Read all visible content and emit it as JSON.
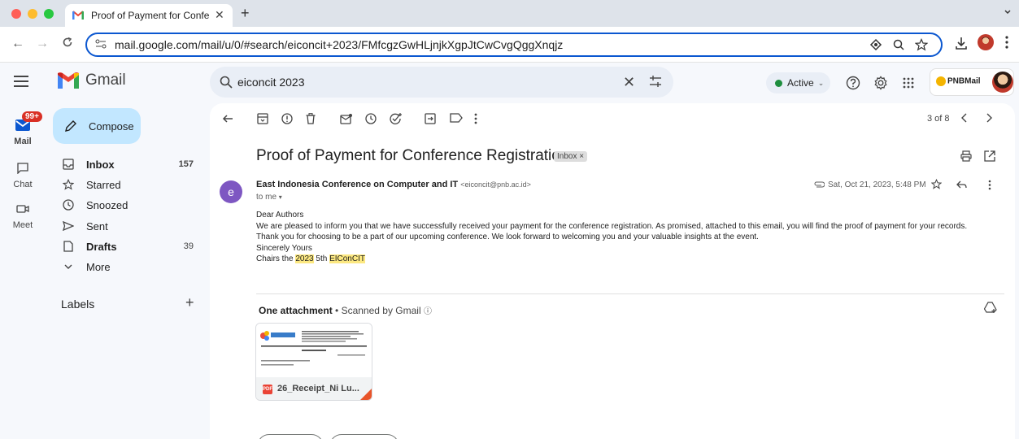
{
  "browser": {
    "tab_title": "Proof of Payment for Confere",
    "url": "mail.google.com/mail/u/0/#search/eiconcit+2023/FMfcgzGwHLjnjkXgpJtCwCvgQggXnqjz"
  },
  "rail": {
    "mail_badge": "99+",
    "mail_label": "Mail",
    "chat_label": "Chat",
    "meet_label": "Meet"
  },
  "brand": {
    "name": "Gmail"
  },
  "compose_label": "Compose",
  "nav": [
    {
      "label": "Inbox",
      "count": "157"
    },
    {
      "label": "Starred",
      "count": ""
    },
    {
      "label": "Snoozed",
      "count": ""
    },
    {
      "label": "Sent",
      "count": ""
    },
    {
      "label": "Drafts",
      "count": "39"
    },
    {
      "label": "More",
      "count": ""
    }
  ],
  "labels_heading": "Labels",
  "search": {
    "query": "eiconcit 2023"
  },
  "status": {
    "label": "Active"
  },
  "account": {
    "logo_text": "PNBMail"
  },
  "pager": {
    "text": "3 of 8"
  },
  "email": {
    "subject": "Proof of Payment for Conference Registration",
    "chip": "Inbox ×",
    "avatar_letter": "e",
    "sender_name": "East Indonesia Conference on Computer and IT",
    "sender_email": "<eiconcit@pnb.ac.id>",
    "to": "to me",
    "date": "Sat, Oct 21, 2023, 5:48 PM",
    "greeting": "Dear Authors",
    "line1": "We are pleased to inform you that we have successfully received your payment for the conference registration. As promised, attached to this email, you will find the proof of payment for your records.",
    "line2": "Thank you for choosing to be a part of our upcoming conference. We look forward to welcoming you and your valuable insights at the event.",
    "closing": "Sincerely Yours",
    "sig_prefix": "Chairs the ",
    "sig_year": "2023",
    "sig_mid": " 5th ",
    "sig_event": "EIConCIT"
  },
  "attachment": {
    "heading": "One attachment",
    "scanned": "Scanned by Gmail",
    "filename": "26_Receipt_Ni Lu...",
    "pdf_label": "PDF"
  },
  "colors": {
    "accent": "#0b57d0",
    "compose_bg": "#c2e7ff",
    "highlight": "#fce881",
    "active_dot": "#1e8e3e",
    "badge": "#d93025"
  }
}
